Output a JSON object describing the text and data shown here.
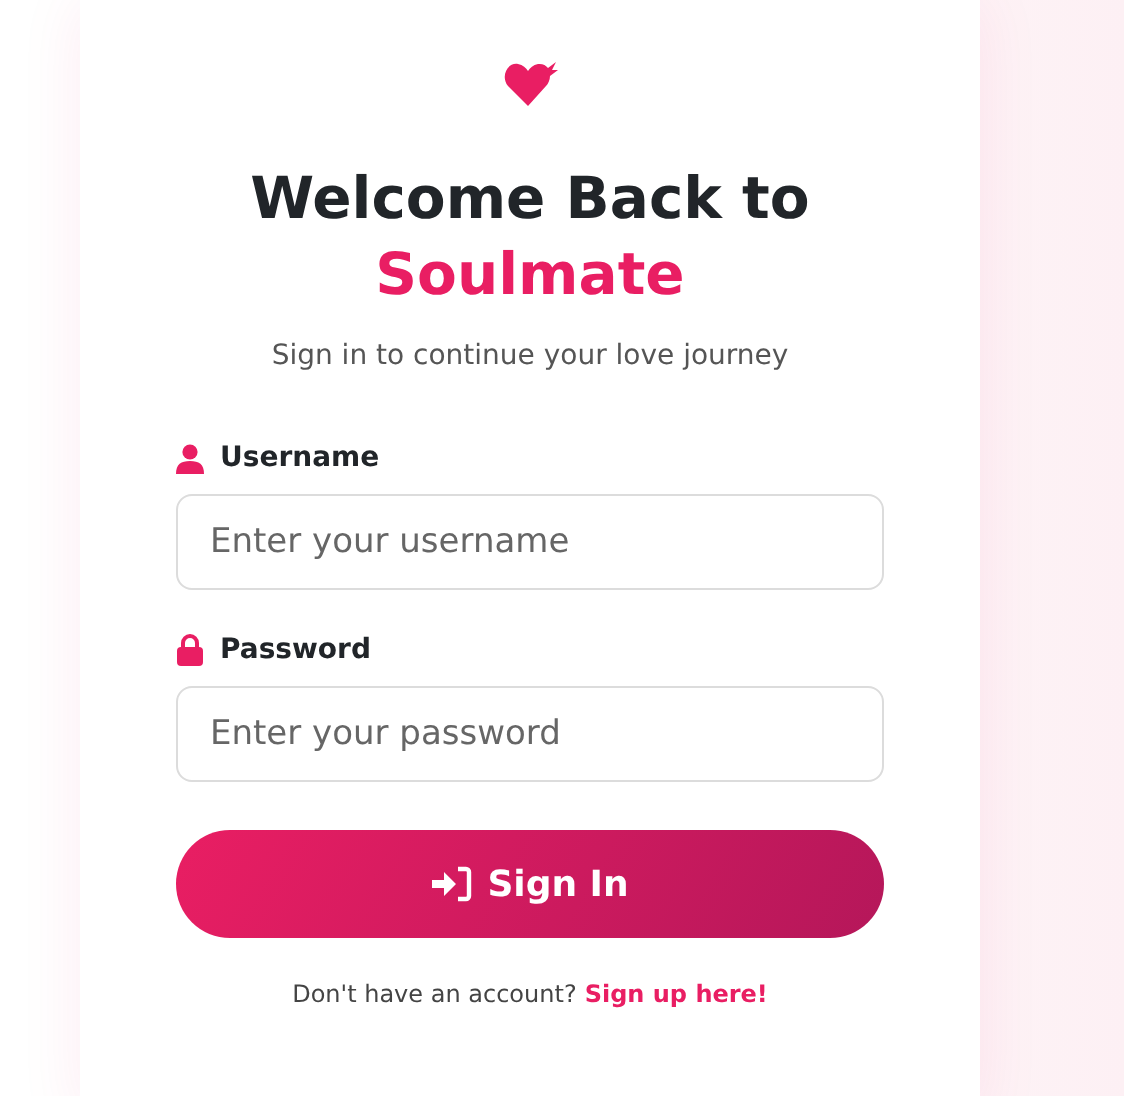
{
  "title": {
    "line_1": "Welcome Back to",
    "brand": "Soulmate"
  },
  "subtitle": "Sign in to continue your love journey",
  "fields": [
    {
      "kind": "user",
      "label": "Username",
      "placeholder": "Enter your username"
    },
    {
      "kind": "lock",
      "label": "Password",
      "placeholder": "Enter your password"
    }
  ],
  "submit": "Sign In",
  "footer": {
    "text": "Don't have an account?",
    "link": "Sign up here!"
  }
}
